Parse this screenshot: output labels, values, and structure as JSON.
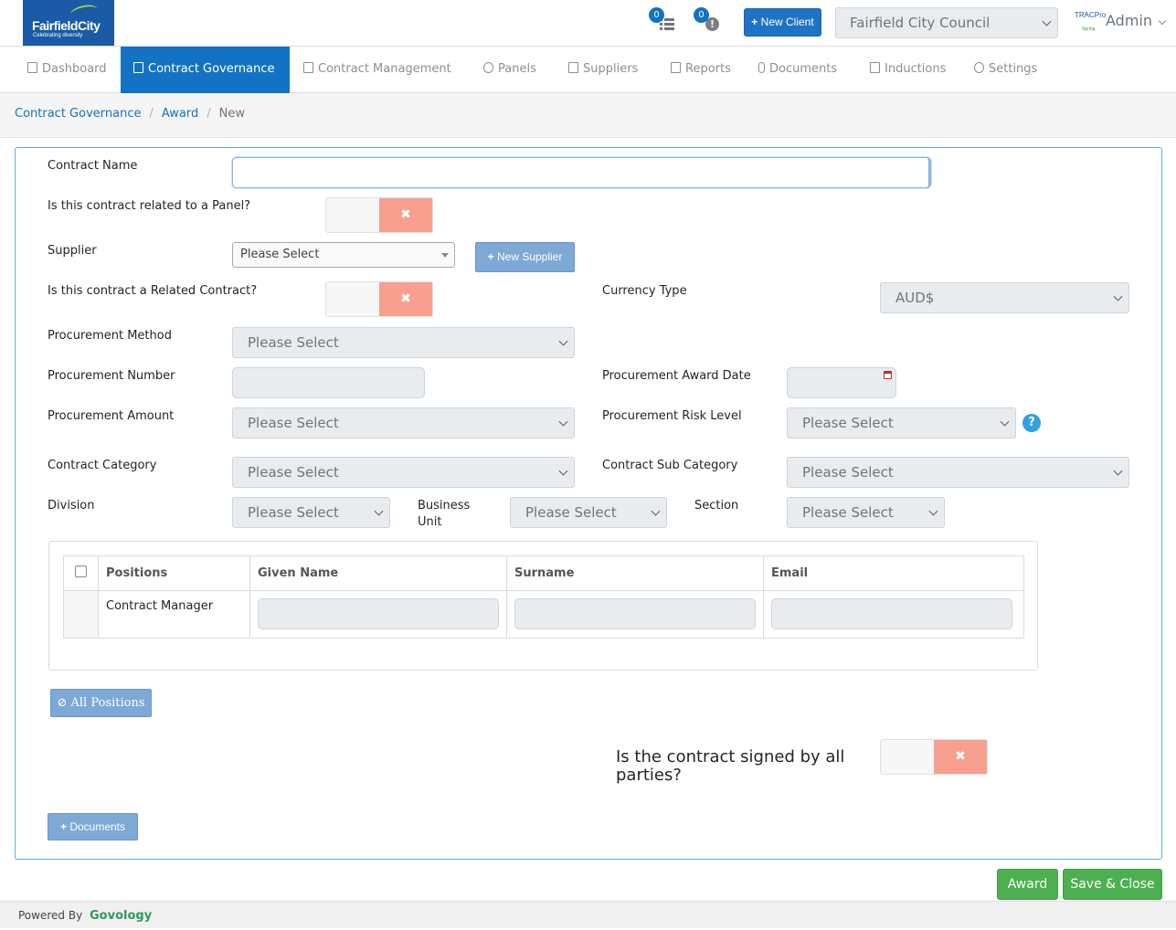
{
  "header": {
    "logo_name": "FairfieldCity",
    "logo_tagline": "Celebrating diversity",
    "tasks_count": "0",
    "alerts_count": "0",
    "new_client_label": "New Client",
    "council_select": "Fairfield City Council",
    "tracpro_logo": "TRACPro",
    "tracpro_sub": "Spring",
    "user_name": "Admin"
  },
  "nav": {
    "items": [
      {
        "label": "Dashboard",
        "icon": "home-icon"
      },
      {
        "label": "Contract Governance",
        "icon": "copy-icon"
      },
      {
        "label": "Contract Management",
        "icon": "document-icon"
      },
      {
        "label": "Panels",
        "icon": "users-icon"
      },
      {
        "label": "Suppliers",
        "icon": "document-icon"
      },
      {
        "label": "Reports",
        "icon": "edit-icon"
      },
      {
        "label": "Documents",
        "icon": "paperclip-icon"
      },
      {
        "label": "Inductions",
        "icon": "file-edit-icon"
      },
      {
        "label": "Settings",
        "icon": "gear-icon"
      }
    ],
    "active": "Contract Governance"
  },
  "breadcrumb": [
    "Contract Governance",
    "Award",
    "New"
  ],
  "form": {
    "contract_name_label": "Contract Name",
    "contract_name_value": "",
    "panel_label": "Is this contract related to a Panel?",
    "supplier_label": "Supplier",
    "supplier_value": "Please Select",
    "new_supplier_label": "New Supplier",
    "related_label": "Is this contract a Related Contract?",
    "currency_label": "Currency Type",
    "currency_value": "AUD$",
    "method_label": "Procurement Method",
    "method_value": "Please Select",
    "number_label": "Procurement Number",
    "award_date_label": "Procurement Award Date",
    "amount_label": "Procurement Amount",
    "amount_value": "Please Select",
    "risk_label": "Procurement Risk Level",
    "risk_value": "Please Select",
    "help_glyph": "?",
    "category_label": "Contract Category",
    "category_value": "Please Select",
    "subcategory_label": "Contract Sub Category",
    "subcategory_value": "Please Select",
    "division_label": "Division",
    "division_value": "Please Select",
    "business_unit_label": "Business Unit",
    "business_unit_value": "Please Select",
    "section_label": "Section",
    "section_value": "Please Select",
    "toggle_off_glyph": "✖",
    "positions_table": {
      "headers": [
        "Positions",
        "Given Name",
        "Surname",
        "Email"
      ],
      "rows": [
        {
          "position": "Contract Manager",
          "given_name": "",
          "surname": "",
          "email": ""
        }
      ]
    },
    "all_positions_label": "All Positions",
    "signed_label": "Is the contract signed by all parties?",
    "documents_label": "Documents"
  },
  "actions": {
    "award_label": "Award",
    "save_close_label": "Save & Close"
  },
  "footer": {
    "powered_by": "Powered By",
    "brand": "Govology"
  },
  "colors": {
    "primary": "#1273c4",
    "success": "#4caf50",
    "toggle_off": "#f8a08f",
    "required": "#e53935"
  }
}
